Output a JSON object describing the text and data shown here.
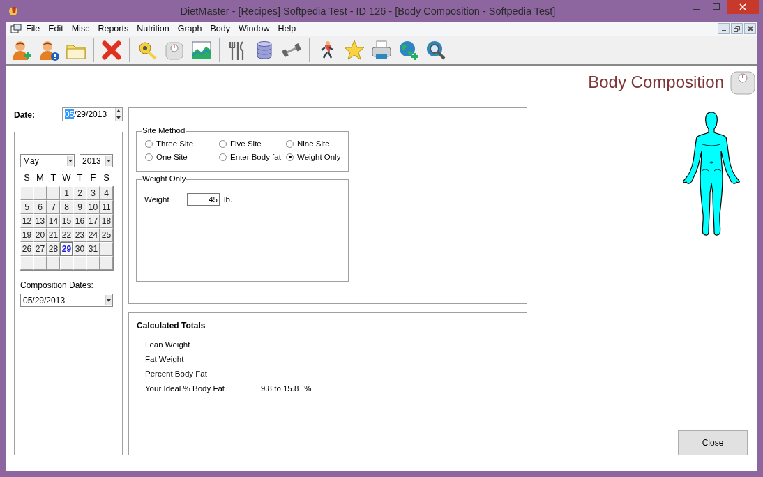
{
  "window": {
    "title": "DietMaster - [Recipes] Softpedia Test - ID 126 - [Body Composition - Softpedia Test]"
  },
  "menu": [
    "File",
    "Edit",
    "Misc",
    "Reports",
    "Nutrition",
    "Graph",
    "Body",
    "Window",
    "Help"
  ],
  "header": {
    "title": "Body Composition"
  },
  "date": {
    "label": "Date:",
    "value_parts": [
      {
        "text": "05",
        "selected": true
      },
      {
        "text": "/29/2013",
        "selected": false
      }
    ]
  },
  "calendar": {
    "month": "May",
    "year": "2013",
    "weekdays": [
      "S",
      "M",
      "T",
      "W",
      "T",
      "F",
      "S"
    ],
    "weeks": [
      [
        {
          "kind": "blank"
        },
        {
          "kind": "blank"
        },
        {
          "kind": "blank"
        },
        {
          "kind": "day",
          "day": "1",
          "selected": false
        },
        {
          "kind": "day",
          "day": "2",
          "selected": false
        },
        {
          "kind": "day",
          "day": "3",
          "selected": false
        },
        {
          "kind": "day",
          "day": "4",
          "selected": false
        }
      ],
      [
        {
          "kind": "day",
          "day": "5",
          "selected": false
        },
        {
          "kind": "day",
          "day": "6",
          "selected": false
        },
        {
          "kind": "day",
          "day": "7",
          "selected": false
        },
        {
          "kind": "day",
          "day": "8",
          "selected": false
        },
        {
          "kind": "day",
          "day": "9",
          "selected": false
        },
        {
          "kind": "day",
          "day": "10",
          "selected": false
        },
        {
          "kind": "day",
          "day": "11",
          "selected": false
        }
      ],
      [
        {
          "kind": "day",
          "day": "12",
          "selected": false
        },
        {
          "kind": "day",
          "day": "13",
          "selected": false
        },
        {
          "kind": "day",
          "day": "14",
          "selected": false
        },
        {
          "kind": "day",
          "day": "15",
          "selected": false
        },
        {
          "kind": "day",
          "day": "16",
          "selected": false
        },
        {
          "kind": "day",
          "day": "17",
          "selected": false
        },
        {
          "kind": "day",
          "day": "18",
          "selected": false
        }
      ],
      [
        {
          "kind": "day",
          "day": "19",
          "selected": false
        },
        {
          "kind": "day",
          "day": "20",
          "selected": false
        },
        {
          "kind": "day",
          "day": "21",
          "selected": false
        },
        {
          "kind": "day",
          "day": "22",
          "selected": false
        },
        {
          "kind": "day",
          "day": "23",
          "selected": false
        },
        {
          "kind": "day",
          "day": "24",
          "selected": false
        },
        {
          "kind": "day",
          "day": "25",
          "selected": false
        }
      ],
      [
        {
          "kind": "day",
          "day": "26",
          "selected": false
        },
        {
          "kind": "day",
          "day": "27",
          "selected": false
        },
        {
          "kind": "day",
          "day": "28",
          "selected": false
        },
        {
          "kind": "day",
          "day": "29",
          "selected": true
        },
        {
          "kind": "day",
          "day": "30",
          "selected": false
        },
        {
          "kind": "day",
          "day": "31",
          "selected": false
        },
        {
          "kind": "blank"
        }
      ],
      [
        {
          "kind": "blank"
        },
        {
          "kind": "blank"
        },
        {
          "kind": "blank"
        },
        {
          "kind": "blank"
        },
        {
          "kind": "blank"
        },
        {
          "kind": "blank"
        },
        {
          "kind": "blank"
        }
      ]
    ]
  },
  "composition_dates": {
    "label": "Composition Dates:",
    "value": "05/29/2013"
  },
  "site_method": {
    "title": "Site Method",
    "options": [
      {
        "label": "Three Site",
        "selected": false
      },
      {
        "label": "Five Site",
        "selected": false
      },
      {
        "label": "Nine Site",
        "selected": false
      },
      {
        "label": "One Site",
        "selected": false
      },
      {
        "label": "Enter Body fat",
        "selected": false
      },
      {
        "label": "Weight Only",
        "selected": true
      }
    ]
  },
  "weight_only": {
    "title": "Weight Only",
    "label": "Weight",
    "value": "45",
    "unit": "lb."
  },
  "totals": {
    "title": "Calculated Totals",
    "rows": [
      {
        "label": "Lean Weight"
      },
      {
        "label": "Fat Weight"
      },
      {
        "label": "Percent Body Fat"
      },
      {
        "label": "Your Ideal % Body Fat",
        "value": "9.8 to 15.8",
        "unit": "%"
      }
    ]
  },
  "close_button": {
    "label": "Close"
  }
}
